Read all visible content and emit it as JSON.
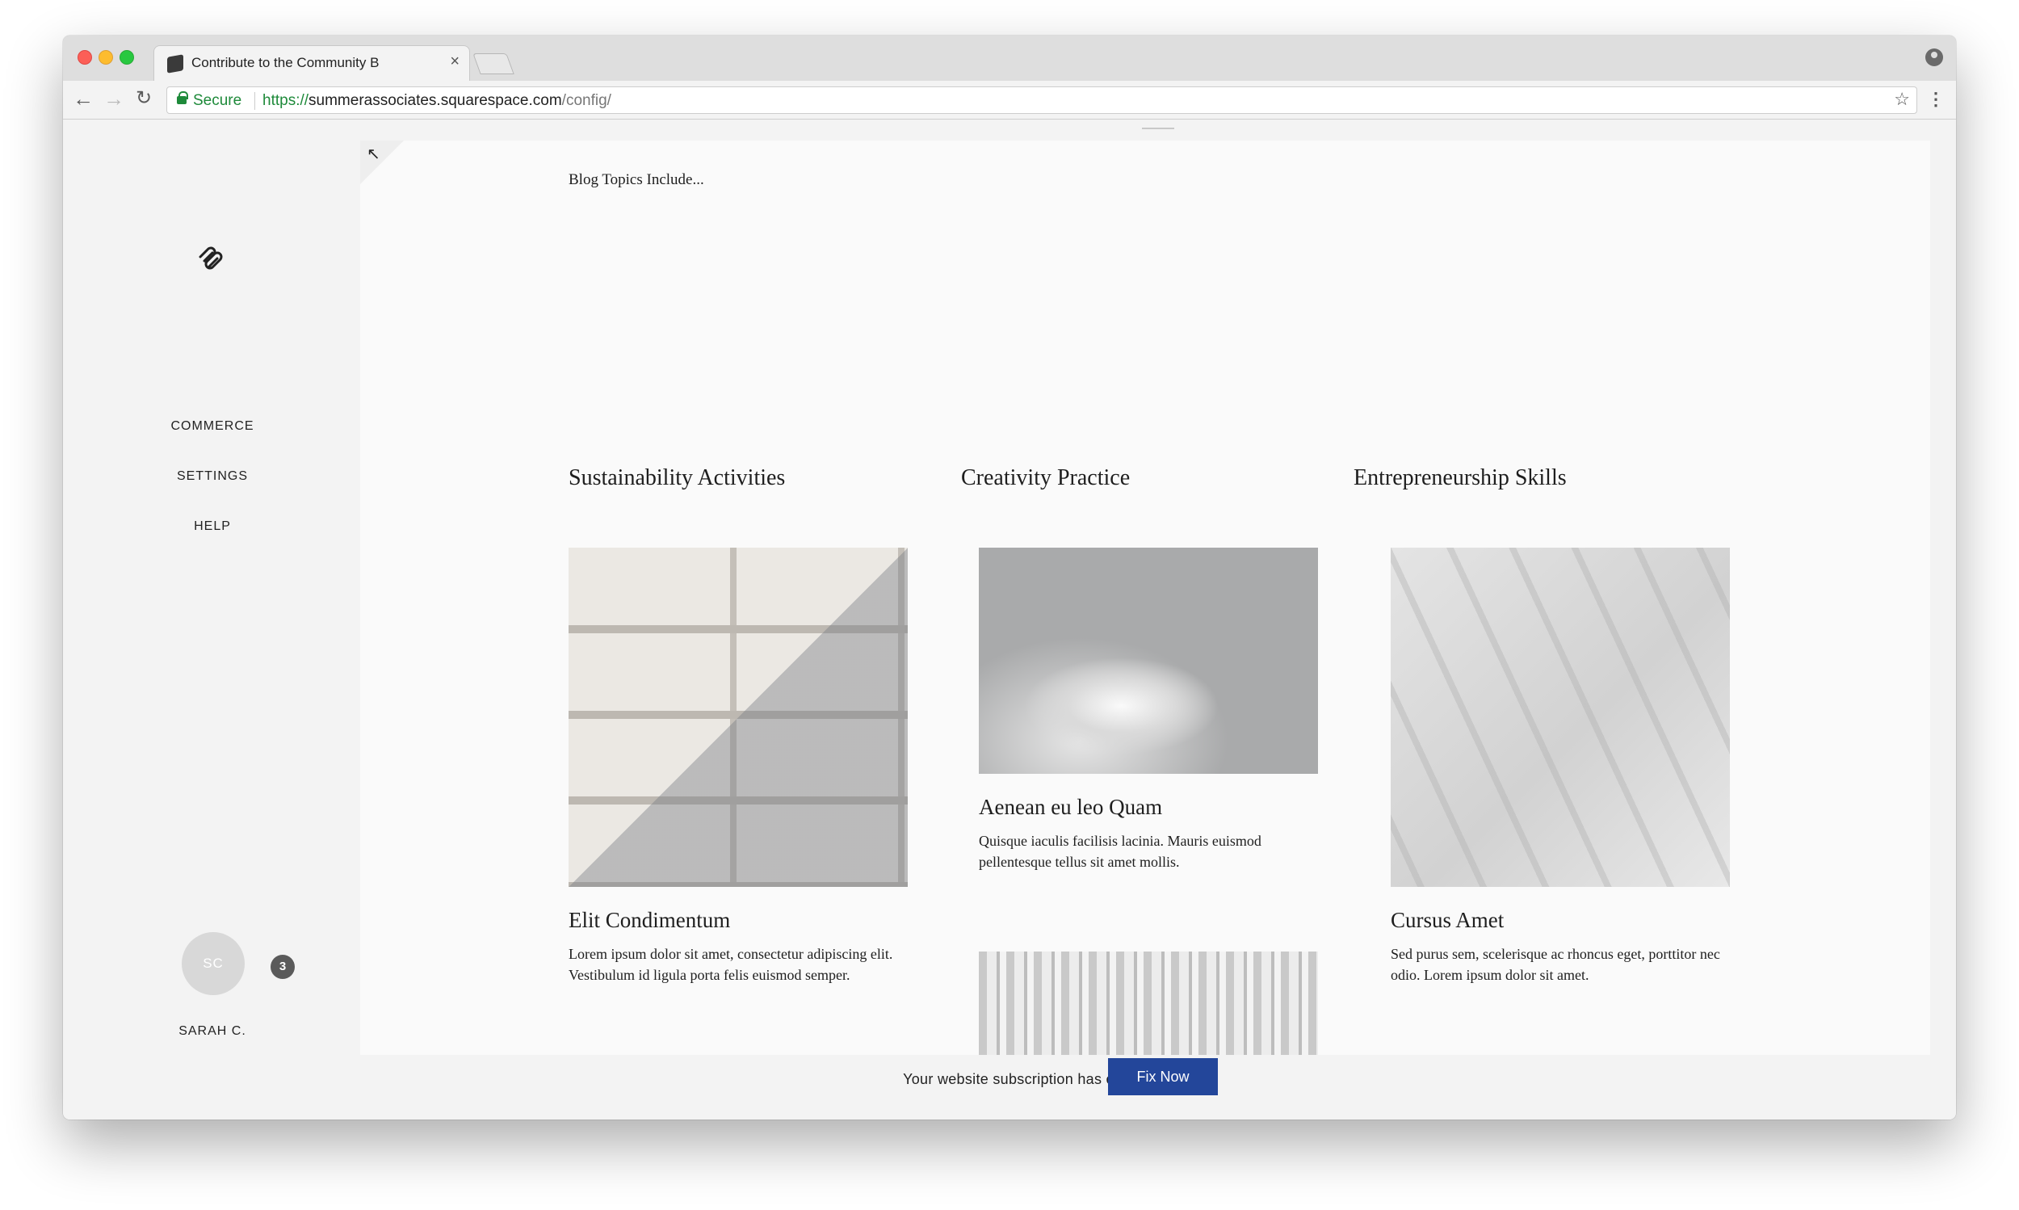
{
  "browser": {
    "tab_title": "Contribute to the Community B",
    "tab_close": "×",
    "secure_label": "Secure",
    "url_scheme": "https://",
    "url_host": "summerassociates.squarespace.com",
    "url_path": "/config/"
  },
  "sidebar": {
    "items": [
      {
        "label": "COMMERCE"
      },
      {
        "label": "SETTINGS"
      },
      {
        "label": "HELP"
      }
    ],
    "user": {
      "initials": "SC",
      "name": "SARAH C.",
      "notification_count": "3"
    }
  },
  "page": {
    "intro": "Blog Topics Include...",
    "sections": [
      {
        "title": "Sustainability Activities"
      },
      {
        "title": "Creativity Practice"
      },
      {
        "title": "Entrepreneurship Skills"
      }
    ],
    "posts": [
      {
        "title": "Elit Condimentum",
        "excerpt": "Lorem ipsum dolor sit amet, consectetur adipiscing elit. Vestibulum id ligula porta felis euismod semper."
      },
      {
        "title": "Aenean eu leo Quam",
        "excerpt": "Quisque iaculis facilisis lacinia. Mauris euismod pellentesque tellus sit amet mollis."
      },
      {
        "title": "Cursus Amet",
        "excerpt": "Sed purus sem, scelerisque ac rhoncus eget, porttitor nec odio. Lorem ipsum dolor sit amet."
      }
    ]
  },
  "notice": {
    "text": "Your website subscription has expired.",
    "button_label": "Fix Now",
    "button_color": "#23469a"
  }
}
